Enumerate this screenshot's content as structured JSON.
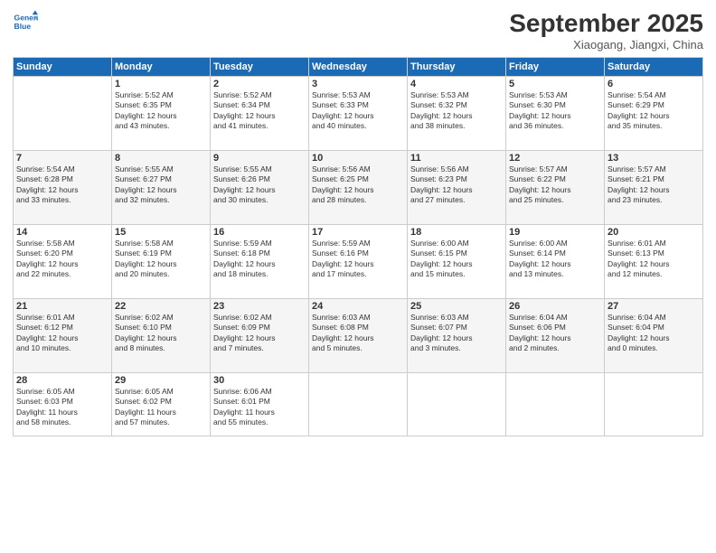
{
  "header": {
    "logo_line1": "General",
    "logo_line2": "Blue",
    "month": "September 2025",
    "location": "Xiaogang, Jiangxi, China"
  },
  "weekdays": [
    "Sunday",
    "Monday",
    "Tuesday",
    "Wednesday",
    "Thursday",
    "Friday",
    "Saturday"
  ],
  "weeks": [
    [
      {
        "day": "",
        "content": ""
      },
      {
        "day": "1",
        "content": "Sunrise: 5:52 AM\nSunset: 6:35 PM\nDaylight: 12 hours\nand 43 minutes."
      },
      {
        "day": "2",
        "content": "Sunrise: 5:52 AM\nSunset: 6:34 PM\nDaylight: 12 hours\nand 41 minutes."
      },
      {
        "day": "3",
        "content": "Sunrise: 5:53 AM\nSunset: 6:33 PM\nDaylight: 12 hours\nand 40 minutes."
      },
      {
        "day": "4",
        "content": "Sunrise: 5:53 AM\nSunset: 6:32 PM\nDaylight: 12 hours\nand 38 minutes."
      },
      {
        "day": "5",
        "content": "Sunrise: 5:53 AM\nSunset: 6:30 PM\nDaylight: 12 hours\nand 36 minutes."
      },
      {
        "day": "6",
        "content": "Sunrise: 5:54 AM\nSunset: 6:29 PM\nDaylight: 12 hours\nand 35 minutes."
      }
    ],
    [
      {
        "day": "7",
        "content": "Sunrise: 5:54 AM\nSunset: 6:28 PM\nDaylight: 12 hours\nand 33 minutes."
      },
      {
        "day": "8",
        "content": "Sunrise: 5:55 AM\nSunset: 6:27 PM\nDaylight: 12 hours\nand 32 minutes."
      },
      {
        "day": "9",
        "content": "Sunrise: 5:55 AM\nSunset: 6:26 PM\nDaylight: 12 hours\nand 30 minutes."
      },
      {
        "day": "10",
        "content": "Sunrise: 5:56 AM\nSunset: 6:25 PM\nDaylight: 12 hours\nand 28 minutes."
      },
      {
        "day": "11",
        "content": "Sunrise: 5:56 AM\nSunset: 6:23 PM\nDaylight: 12 hours\nand 27 minutes."
      },
      {
        "day": "12",
        "content": "Sunrise: 5:57 AM\nSunset: 6:22 PM\nDaylight: 12 hours\nand 25 minutes."
      },
      {
        "day": "13",
        "content": "Sunrise: 5:57 AM\nSunset: 6:21 PM\nDaylight: 12 hours\nand 23 minutes."
      }
    ],
    [
      {
        "day": "14",
        "content": "Sunrise: 5:58 AM\nSunset: 6:20 PM\nDaylight: 12 hours\nand 22 minutes."
      },
      {
        "day": "15",
        "content": "Sunrise: 5:58 AM\nSunset: 6:19 PM\nDaylight: 12 hours\nand 20 minutes."
      },
      {
        "day": "16",
        "content": "Sunrise: 5:59 AM\nSunset: 6:18 PM\nDaylight: 12 hours\nand 18 minutes."
      },
      {
        "day": "17",
        "content": "Sunrise: 5:59 AM\nSunset: 6:16 PM\nDaylight: 12 hours\nand 17 minutes."
      },
      {
        "day": "18",
        "content": "Sunrise: 6:00 AM\nSunset: 6:15 PM\nDaylight: 12 hours\nand 15 minutes."
      },
      {
        "day": "19",
        "content": "Sunrise: 6:00 AM\nSunset: 6:14 PM\nDaylight: 12 hours\nand 13 minutes."
      },
      {
        "day": "20",
        "content": "Sunrise: 6:01 AM\nSunset: 6:13 PM\nDaylight: 12 hours\nand 12 minutes."
      }
    ],
    [
      {
        "day": "21",
        "content": "Sunrise: 6:01 AM\nSunset: 6:12 PM\nDaylight: 12 hours\nand 10 minutes."
      },
      {
        "day": "22",
        "content": "Sunrise: 6:02 AM\nSunset: 6:10 PM\nDaylight: 12 hours\nand 8 minutes."
      },
      {
        "day": "23",
        "content": "Sunrise: 6:02 AM\nSunset: 6:09 PM\nDaylight: 12 hours\nand 7 minutes."
      },
      {
        "day": "24",
        "content": "Sunrise: 6:03 AM\nSunset: 6:08 PM\nDaylight: 12 hours\nand 5 minutes."
      },
      {
        "day": "25",
        "content": "Sunrise: 6:03 AM\nSunset: 6:07 PM\nDaylight: 12 hours\nand 3 minutes."
      },
      {
        "day": "26",
        "content": "Sunrise: 6:04 AM\nSunset: 6:06 PM\nDaylight: 12 hours\nand 2 minutes."
      },
      {
        "day": "27",
        "content": "Sunrise: 6:04 AM\nSunset: 6:04 PM\nDaylight: 12 hours\nand 0 minutes."
      }
    ],
    [
      {
        "day": "28",
        "content": "Sunrise: 6:05 AM\nSunset: 6:03 PM\nDaylight: 11 hours\nand 58 minutes."
      },
      {
        "day": "29",
        "content": "Sunrise: 6:05 AM\nSunset: 6:02 PM\nDaylight: 11 hours\nand 57 minutes."
      },
      {
        "day": "30",
        "content": "Sunrise: 6:06 AM\nSunset: 6:01 PM\nDaylight: 11 hours\nand 55 minutes."
      },
      {
        "day": "",
        "content": ""
      },
      {
        "day": "",
        "content": ""
      },
      {
        "day": "",
        "content": ""
      },
      {
        "day": "",
        "content": ""
      }
    ]
  ]
}
